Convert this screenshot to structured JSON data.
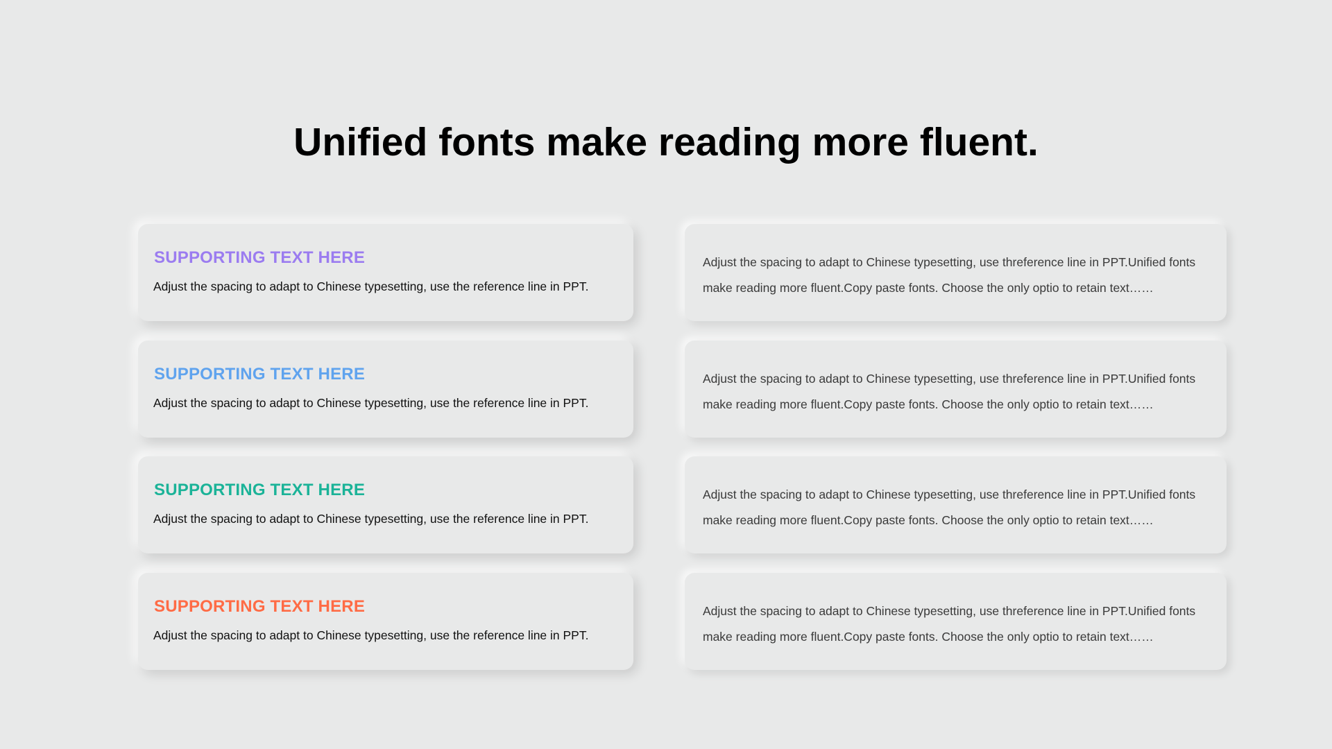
{
  "title": "Unified fonts make reading more fluent.",
  "colors": {
    "background": "#e8e9e9",
    "purple": "#9b7cf0",
    "blue": "#5fa3ee",
    "green": "#1bb398",
    "orange": "#ff6b45"
  },
  "left_cards": [
    {
      "heading": "SUPPORTING TEXT HERE",
      "body": "Adjust the spacing to adapt to Chinese typesetting, use the reference line in PPT."
    },
    {
      "heading": "SUPPORTING TEXT HERE",
      "body": "Adjust the spacing to adapt to Chinese typesetting, use the reference line in PPT."
    },
    {
      "heading": "SUPPORTING TEXT HERE",
      "body": "Adjust the spacing to adapt to Chinese typesetting, use the reference line in PPT."
    },
    {
      "heading": "SUPPORTING TEXT HERE",
      "body": "Adjust the spacing to adapt to Chinese typesetting, use the reference line in PPT."
    }
  ],
  "right_cards": [
    {
      "body": "Adjust the spacing to adapt to Chinese typesetting, use threference line in PPT.Unified fonts make reading more fluent.Copy paste fonts. Choose the only optio to retain text……"
    },
    {
      "body": "Adjust the spacing to adapt to Chinese typesetting, use threference line in PPT.Unified fonts make reading more fluent.Copy paste fonts. Choose the only optio to retain text……"
    },
    {
      "body": "Adjust the spacing to adapt to Chinese typesetting, use threference line in PPT.Unified fonts make reading more fluent.Copy paste fonts. Choose the only optio to retain text……"
    },
    {
      "body": "Adjust the spacing to adapt to Chinese typesetting, use threference line in PPT.Unified fonts make reading more fluent.Copy paste fonts. Choose the only optio to retain text……"
    }
  ]
}
